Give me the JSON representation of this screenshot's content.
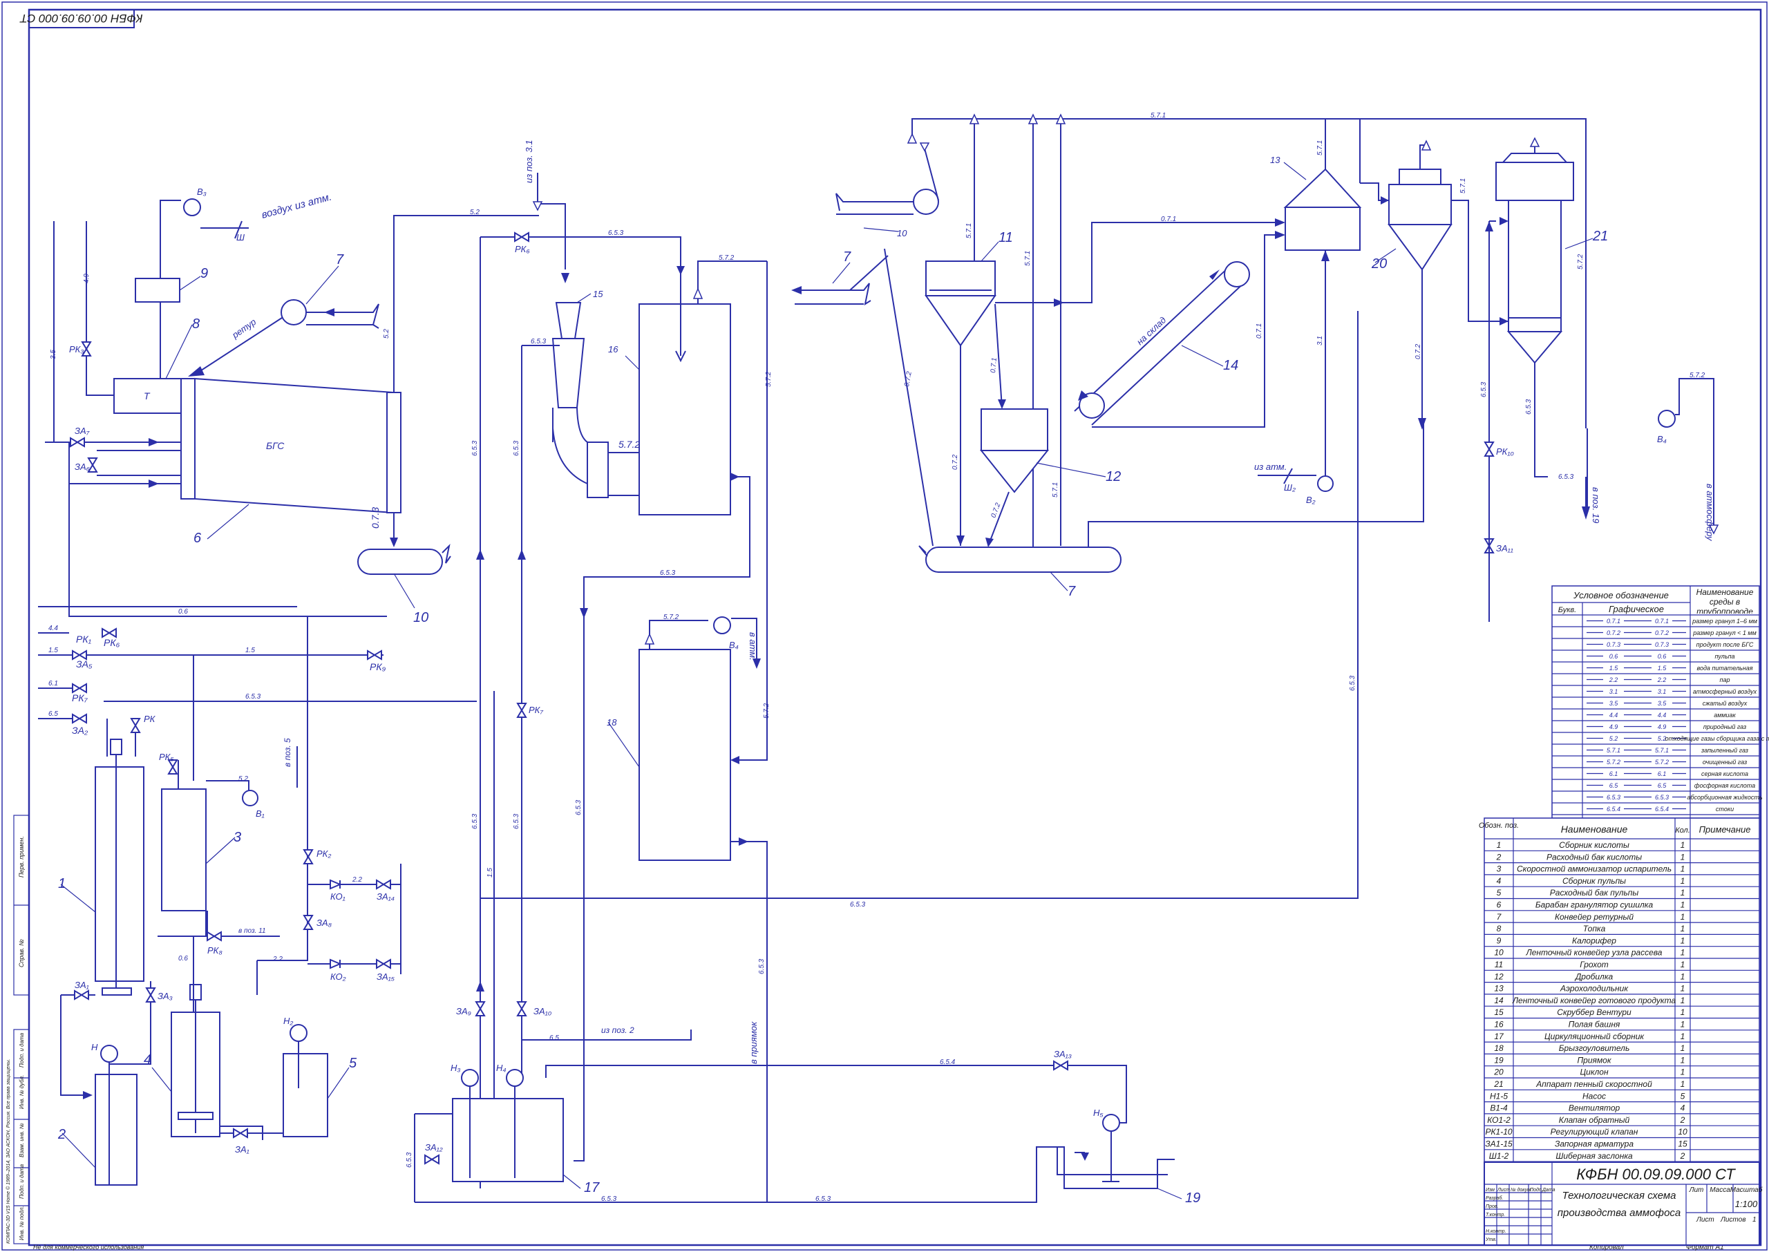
{
  "drawing_code": "КФБН 00.09.09.000 СТ",
  "drawing_code_rotated": "КФБН 00.09.09.000 СТ",
  "title_line1": "Технологическая схема",
  "title_line2": "производства аммофоса",
  "scale": "1:100",
  "sheet_label": "Лист",
  "sheets_label": "Листов",
  "sheets_count": "1",
  "lit_label": "Лит",
  "mass_label": "Масса",
  "scale_label": "Масштаб",
  "stamp_rows": [
    "Изм",
    "Лист",
    "№ докум.",
    "Подп.",
    "Дата",
    "Разраб.",
    "Пров.",
    "Т.контр.",
    "Н.контр.",
    "Утв."
  ],
  "copied_label": "Копировал",
  "format_label": "Формат  А1",
  "noncommercial": "Не для коммерческого использования",
  "left_strip": [
    "Перв. примен.",
    "Справ. №",
    "Подп. и дата",
    "Инв. № дубл.",
    "Взам. инв. №",
    "Подп. и дата",
    "Инв. № подл."
  ],
  "copyright": "КОМПАС-3D V15 Home © 1989–2014, ЗАО АСКОН, Россия. Все права защищены.",
  "legend": {
    "header_symbol": "Условное обозначение",
    "header_letter": "Букв.",
    "header_graphic": "Графическое",
    "header_medium": "Наименование среды в трубопроводе",
    "rows": [
      {
        "code": "0.7.1",
        "name": "размер гранул 1–6 мм"
      },
      {
        "code": "0.7.2",
        "name": "размер гранул < 1 мм"
      },
      {
        "code": "0.7.3",
        "name": "продукт после БГС"
      },
      {
        "code": "0.6",
        "name": "пульпа"
      },
      {
        "code": "1.5",
        "name": "вода питательная"
      },
      {
        "code": "2.2",
        "name": "пар"
      },
      {
        "code": "3.1",
        "name": "атмосферный воздух"
      },
      {
        "code": "3.5",
        "name": "сжатый воздух"
      },
      {
        "code": "4.4",
        "name": "аммиак"
      },
      {
        "code": "4.9",
        "name": "природный газ"
      },
      {
        "code": "5.2",
        "name": "отходящие газы сборщика газа с топки"
      },
      {
        "code": "5.7.1",
        "name": "запыленный газ"
      },
      {
        "code": "5.7.2",
        "name": "очищенный газ"
      },
      {
        "code": "6.1",
        "name": "серная кислота"
      },
      {
        "code": "6.5",
        "name": "фосфорная кислота"
      },
      {
        "code": "6.5.3",
        "name": "абсорбционная жидкость"
      },
      {
        "code": "6.5.4",
        "name": "стоки"
      }
    ]
  },
  "spec": {
    "header_pos": "Обозн. поз.",
    "header_name": "Наименование",
    "header_qty": "Кол.",
    "header_note": "Примечание",
    "rows": [
      {
        "pos": "1",
        "name": "Сборник кислоты",
        "qty": "1"
      },
      {
        "pos": "2",
        "name": "Расходный бак кислоты",
        "qty": "1"
      },
      {
        "pos": "3",
        "name": "Скоростной аммонизатор испаритель",
        "qty": "1"
      },
      {
        "pos": "4",
        "name": "Сборник пульпы",
        "qty": "1"
      },
      {
        "pos": "5",
        "name": "Расходный бак пульпы",
        "qty": "1"
      },
      {
        "pos": "6",
        "name": "Барабан гранулятор сушилка",
        "qty": "1"
      },
      {
        "pos": "7",
        "name": "Конвейер ретурный",
        "qty": "1"
      },
      {
        "pos": "8",
        "name": "Топка",
        "qty": "1"
      },
      {
        "pos": "9",
        "name": "Калорифер",
        "qty": "1"
      },
      {
        "pos": "10",
        "name": "Ленточный конвейер узла рассева",
        "qty": "1"
      },
      {
        "pos": "11",
        "name": "Грохот",
        "qty": "1"
      },
      {
        "pos": "12",
        "name": "Дробилка",
        "qty": "1"
      },
      {
        "pos": "13",
        "name": "Аэрохолодильник",
        "qty": "1"
      },
      {
        "pos": "14",
        "name": "Ленточный конвейер готового продукта",
        "qty": "1"
      },
      {
        "pos": "15",
        "name": "Скруббер Вентури",
        "qty": "1"
      },
      {
        "pos": "16",
        "name": "Полая башня",
        "qty": "1"
      },
      {
        "pos": "17",
        "name": "Циркуляционный сборник",
        "qty": "1"
      },
      {
        "pos": "18",
        "name": "Брызгоуловитель",
        "qty": "1"
      },
      {
        "pos": "19",
        "name": "Приямок",
        "qty": "1"
      },
      {
        "pos": "20",
        "name": "Циклон",
        "qty": "1"
      },
      {
        "pos": "21",
        "name": "Аппарат пенный скоростной",
        "qty": "1"
      },
      {
        "pos": "Н1-5",
        "name": "Насос",
        "qty": "5"
      },
      {
        "pos": "В1-4",
        "name": "Вентилятор",
        "qty": "4"
      },
      {
        "pos": "КО1-2",
        "name": "Клапан обратный",
        "qty": "2"
      },
      {
        "pos": "РК1-10",
        "name": "Регулирующий клапан",
        "qty": "10"
      },
      {
        "pos": "ЗА1-15",
        "name": "Запорная арматура",
        "qty": "15"
      },
      {
        "pos": "Ш1-2",
        "name": "Шиберная заслонка",
        "qty": "2"
      }
    ]
  },
  "labels": {
    "bgs": "БГС",
    "topka": "Т",
    "air_from_atm": "воздух из атм.",
    "from_atm": "из атм.",
    "to_warehouse": "на склад",
    "retur": "ретур",
    "from_pos_31": "из поз. 3.1",
    "to_pos_11": "в поз. 11",
    "to_pos_5": "в поз. 5",
    "to_atm": "в атм.",
    "to_atmosphere": "в атмосферу",
    "to_pos_19": "в поз. 19",
    "from_pos_2": "из поз. 2",
    "to_pit": "в приямок"
  }
}
